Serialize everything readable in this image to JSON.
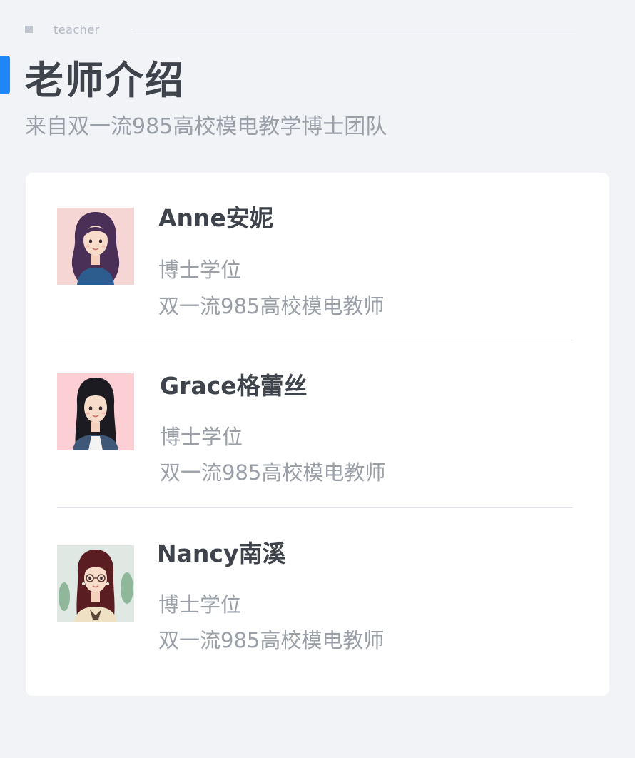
{
  "header": {
    "tag": "teacher",
    "title": "老师介绍",
    "subtitle": "来自双一流985高校模电教学博士团队"
  },
  "teachers": [
    {
      "name": "Anne安妮",
      "degree": "博士学位",
      "desc": "双一流985高校模电教师",
      "avatar_bg": "#f6d6d4"
    },
    {
      "name": "Grace格蕾丝",
      "degree": "博士学位",
      "desc": "双一流985高校模电教师",
      "avatar_bg": "#fbcfd3"
    },
    {
      "name": "Nancy南溪",
      "degree": "博士学位",
      "desc": "双一流985高校模电教师",
      "avatar_bg": "#dfe8e3"
    }
  ],
  "colors": {
    "accent": "#1e86f5",
    "title": "#3f444c",
    "muted": "#9a9fa8",
    "background": "#f2f3f7"
  }
}
